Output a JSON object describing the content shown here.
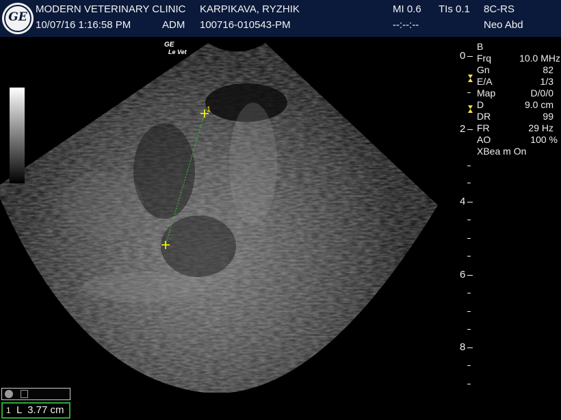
{
  "header": {
    "clinic": "MODERN VETERINARY CLINIC",
    "datetime": "10/07/16 1:16:58 PM",
    "operator": "ADM",
    "patient": "KARPIKAVA, RYZHIK",
    "exam_id": "100716-010543-PM",
    "mi": "MI 0.6",
    "tis": "TIs 0.1",
    "timer": "--:--:--",
    "probe": "8C-RS",
    "preset": "Neo Abd"
  },
  "brand": {
    "line1": "GE",
    "line2": "Le Vet"
  },
  "params": {
    "mode": "B",
    "rows": [
      {
        "label": "Frq",
        "value": "10.0 MHz"
      },
      {
        "label": "Gn",
        "value": "82"
      },
      {
        "label": "E/A",
        "value": "1/3"
      },
      {
        "label": "Map",
        "value": "D/0/0"
      },
      {
        "label": "D",
        "value": "9.0 cm"
      },
      {
        "label": "DR",
        "value": "99"
      },
      {
        "label": "FR",
        "value": "29 Hz"
      },
      {
        "label": "AO",
        "value": "100 %"
      }
    ],
    "xbeam": "XBea m On"
  },
  "depth_scale": [
    "0",
    "2",
    "4",
    "6",
    "8"
  ],
  "caliper": {
    "start_label": "1"
  },
  "measurement": {
    "index": "1",
    "text": "L  3.77 cm"
  },
  "colors": {
    "header_bg": "#0b1a3a",
    "caliper": "#ffff00",
    "caliper_line": "#33cc33",
    "focus_marker": "#ffe34d",
    "measure_border": "#2eaa3a"
  }
}
